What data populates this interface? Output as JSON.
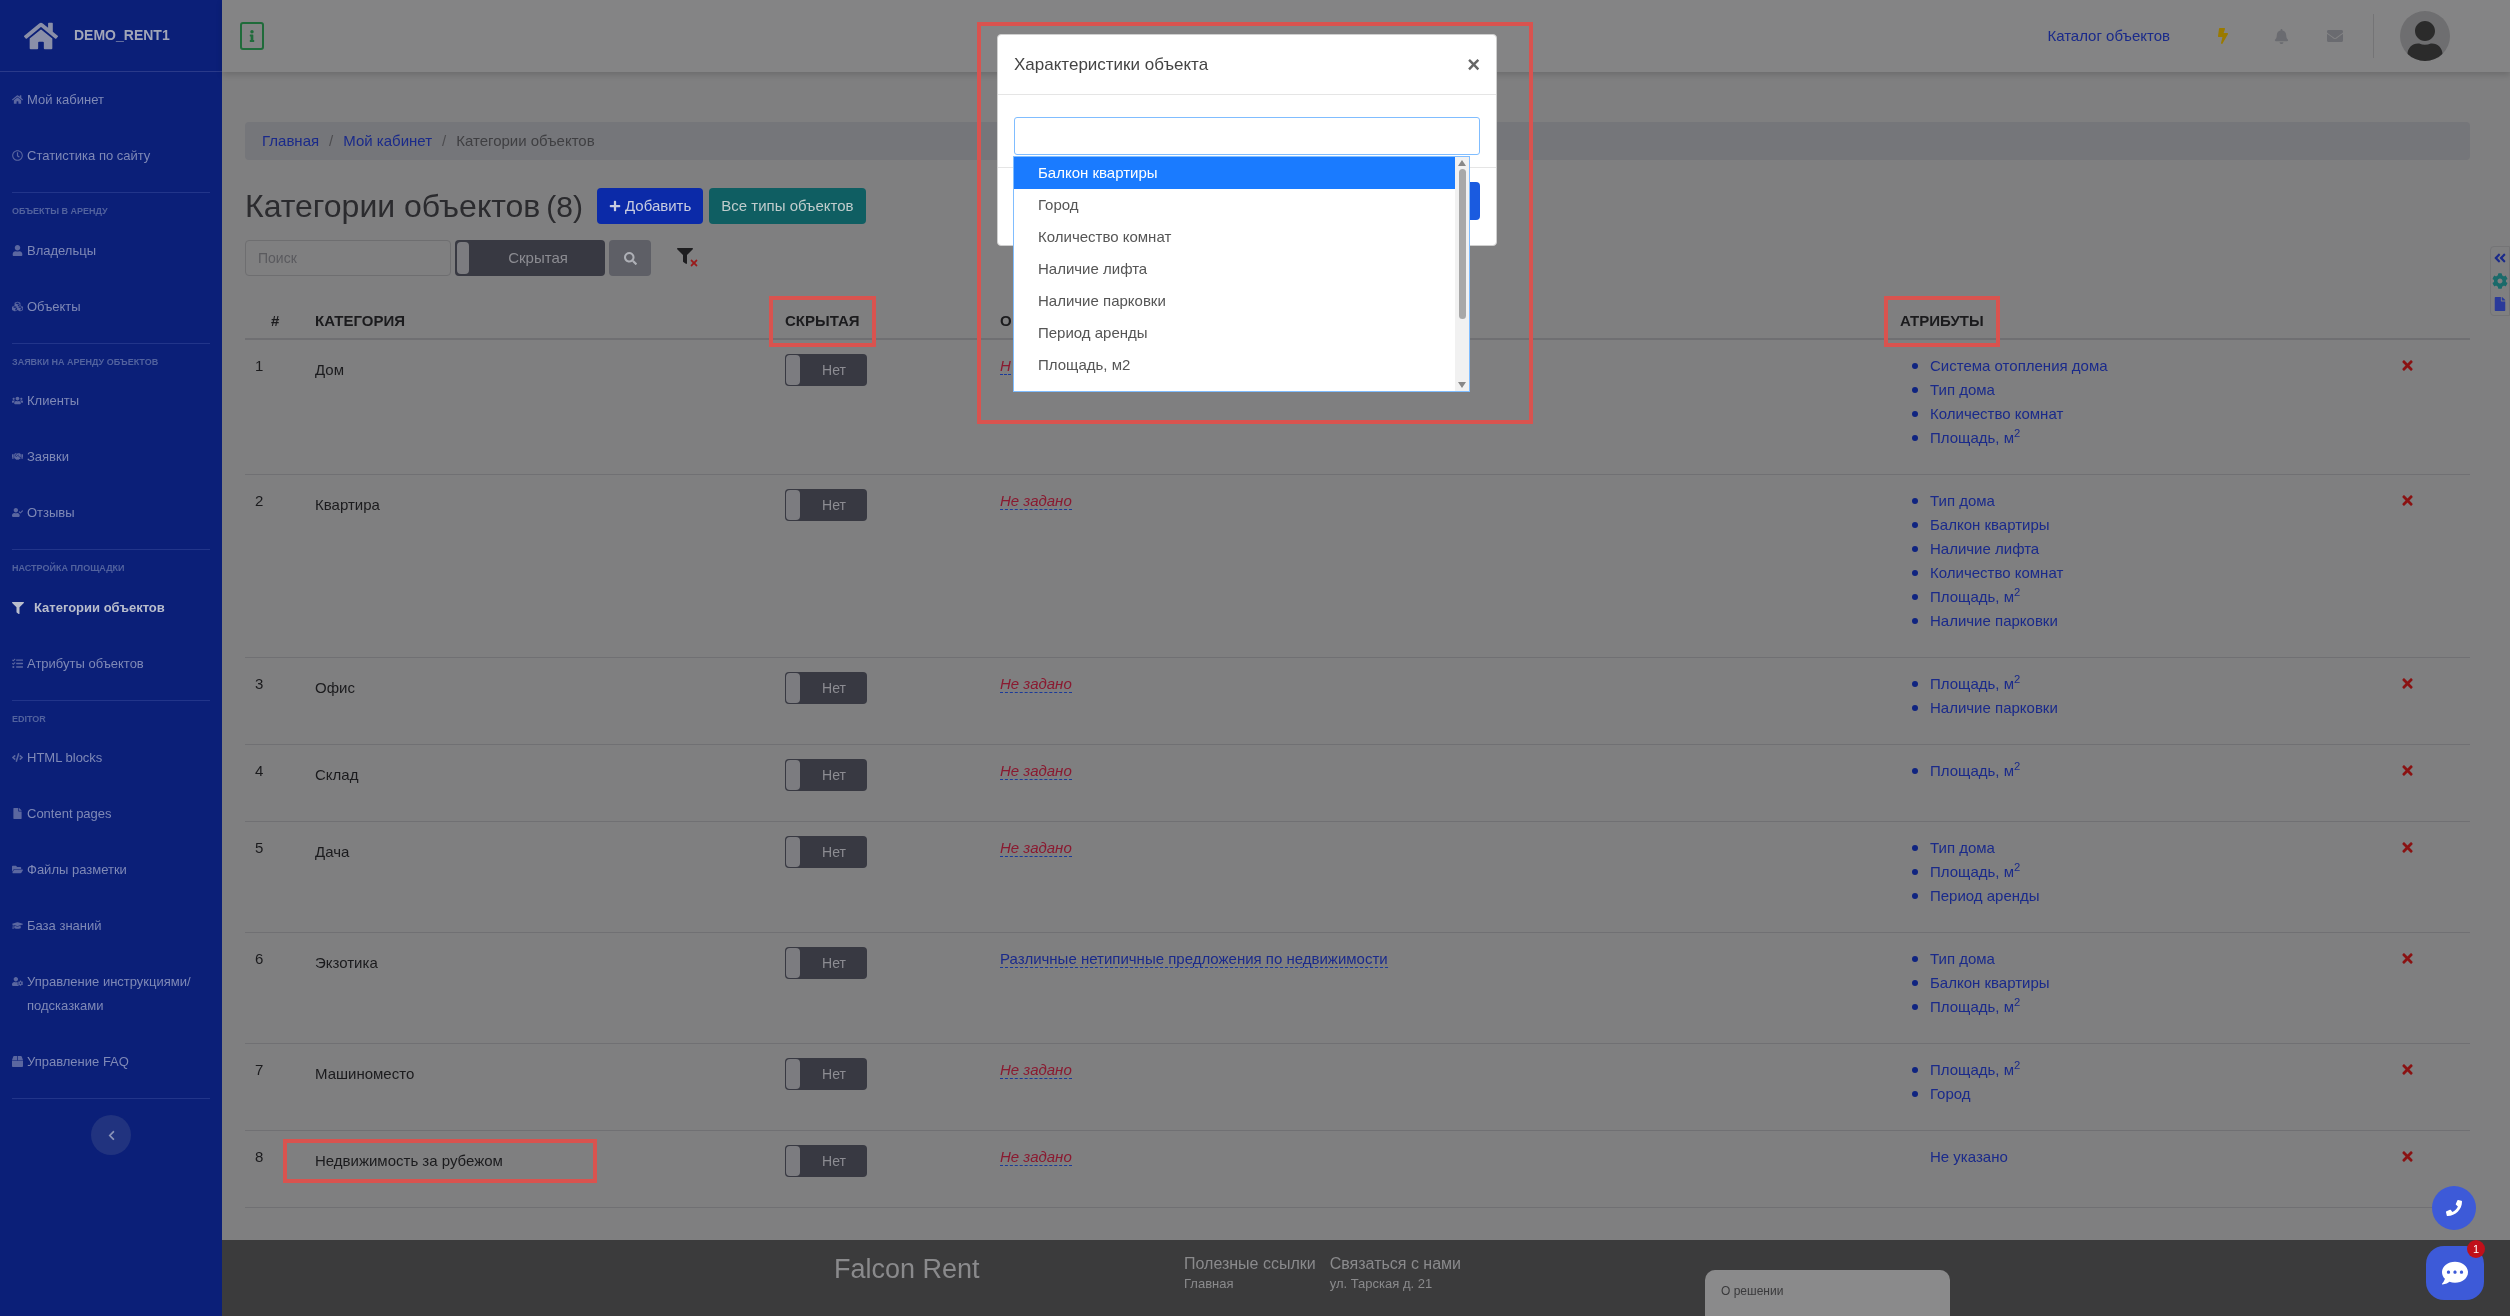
{
  "sidebar": {
    "brand": "DEMO_RENT1",
    "groups": [
      {
        "items": [
          {
            "label": "Мой кабинет",
            "selected": false
          },
          {
            "label": "Статистика по сайту",
            "selected": false
          }
        ]
      },
      {
        "heading": "ОБЪЕКТЫ В АРЕНДУ",
        "items": [
          {
            "label": "Владельцы",
            "selected": false
          },
          {
            "label": "Объекты",
            "selected": false
          }
        ]
      },
      {
        "heading": "ЗАЯВКИ НА АРЕНДУ ОБЪЕКТОВ",
        "items": [
          {
            "label": "Клиенты",
            "selected": false
          },
          {
            "label": "Заявки",
            "selected": false
          },
          {
            "label": "Отзывы",
            "selected": false
          }
        ]
      },
      {
        "heading": "НАСТРОЙКА ПЛОЩАДКИ",
        "items": [
          {
            "label": "Категории объектов",
            "selected": true
          },
          {
            "label": "Атрибуты объектов",
            "selected": false
          }
        ]
      },
      {
        "heading": "EDITOR",
        "items": [
          {
            "label": "HTML blocks",
            "selected": false
          },
          {
            "label": "Content pages",
            "selected": false
          },
          {
            "label": "Файлы разметки",
            "selected": false
          },
          {
            "label": "База знаний",
            "selected": false
          },
          {
            "label": "Управление инструкциями/подсказками",
            "selected": false
          },
          {
            "label": "Управление FAQ",
            "selected": false
          }
        ]
      }
    ]
  },
  "header": {
    "catalog_link": "Каталог объектов",
    "breadcrumb_separator": "/"
  },
  "breadcrumb": [
    {
      "label": "Главная",
      "current": false
    },
    {
      "label": "Мой кабинет",
      "current": false
    },
    {
      "label": "Категории объектов",
      "current": true
    }
  ],
  "page": {
    "title": "Категории объектов",
    "count": "(8)",
    "add_button": "Добавить",
    "types_button": "Все типы объектов"
  },
  "filters": {
    "search_placeholder": "Поиск",
    "hidden_toggle": "Скрытая"
  },
  "table": {
    "columns": [
      {
        "label": "#",
        "highlighted": false
      },
      {
        "label": "КАТЕГОРИЯ",
        "highlighted": false
      },
      {
        "label": "СКРЫТАЯ",
        "highlighted": true
      },
      {
        "label": "О",
        "highlighted": false
      },
      {
        "label": "АТРИБУТЫ",
        "highlighted": true
      }
    ],
    "rows": [
      {
        "num": "1",
        "category": "Дом",
        "category_highlighted": false,
        "hidden_label": "Нет",
        "hidden_on": false,
        "description": "Н",
        "description_set": false,
        "attributes": [
          "Система отопления дома",
          "Тип дома",
          "Количество комнат",
          "Площадь, м$^{2}$"
        ]
      },
      {
        "num": "2",
        "category": "Квартира",
        "category_highlighted": false,
        "hidden_label": "Нет",
        "hidden_on": false,
        "description": "Не задано",
        "description_set": false,
        "attributes": [
          "Тип дома",
          "Балкон квартиры",
          "Наличие лифта",
          "Количество комнат",
          "Площадь, м$^{2}$",
          "Наличие парковки"
        ]
      },
      {
        "num": "3",
        "category": "Офис",
        "category_highlighted": false,
        "hidden_label": "Нет",
        "hidden_on": false,
        "description": "Не задано",
        "description_set": false,
        "attributes": [
          "Площадь, м$^{2}$",
          "Наличие парковки"
        ]
      },
      {
        "num": "4",
        "category": "Склад",
        "category_highlighted": false,
        "hidden_label": "Нет",
        "hidden_on": false,
        "description": "Не задано",
        "description_set": false,
        "attributes": [
          "Площадь, м$^{2}$"
        ]
      },
      {
        "num": "5",
        "category": "Дача",
        "category_highlighted": false,
        "hidden_label": "Нет",
        "hidden_on": false,
        "description": "Не задано",
        "description_set": false,
        "attributes": [
          "Тип дома",
          "Площадь, м$^{2}$",
          "Период аренды"
        ]
      },
      {
        "num": "6",
        "category": "Экзотика",
        "category_highlighted": false,
        "hidden_label": "Нет",
        "hidden_on": false,
        "description": "Различные нетипичные предложения по недвижимости",
        "description_set": true,
        "attributes": [
          "Тип дома",
          "Балкон квартиры",
          "Площадь, м$^{2}$"
        ]
      },
      {
        "num": "7",
        "category": "Машиноместо",
        "category_highlighted": false,
        "hidden_label": "Нет",
        "hidden_on": false,
        "description": "Не задано",
        "description_set": false,
        "attributes": [
          "Площадь, м$^{2}$",
          "Город"
        ]
      },
      {
        "num": "8",
        "category": "Недвижимость за рубежом",
        "category_highlighted": true,
        "hidden_label": "Нет",
        "hidden_on": false,
        "description": "Не задано",
        "description_set": false,
        "attributes": [],
        "attributes_note": "Не указано"
      }
    ]
  },
  "modal": {
    "title": "Характеристики объекта",
    "close": "×",
    "highlighted": true,
    "options": [
      {
        "label": "Балкон квартиры",
        "selected": true
      },
      {
        "label": "Город",
        "selected": false
      },
      {
        "label": "Количество комнат",
        "selected": false
      },
      {
        "label": "Наличие лифта",
        "selected": false
      },
      {
        "label": "Наличие парковки",
        "selected": false
      },
      {
        "label": "Период аренды",
        "selected": false
      },
      {
        "label": "Площадь, м2",
        "selected": false
      }
    ]
  },
  "footer": {
    "brand": "Falcon Rent",
    "columns": [
      {
        "title": "Полезные ссылки",
        "lines": [
          "Главная"
        ]
      },
      {
        "title": "Связаться с нами",
        "lines": [
          "ул. Тарская д. 21"
        ]
      }
    ],
    "card_title": "О решении"
  },
  "chat": {
    "badge": "1"
  }
}
